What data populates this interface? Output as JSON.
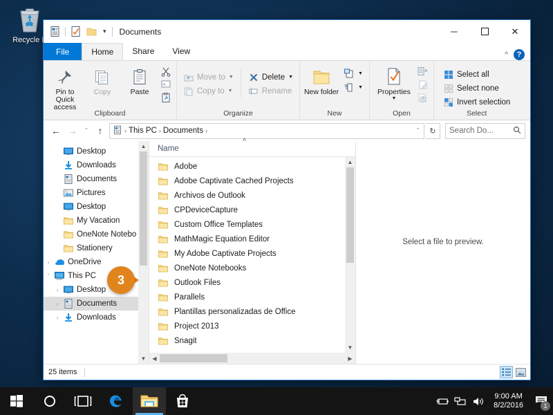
{
  "desktop": {
    "icons": [
      {
        "label": "Recycle B",
        "name": "recycle-bin"
      }
    ]
  },
  "window": {
    "title": "Documents",
    "quick_access": [
      "documents-icon",
      "properties-icon",
      "folder-icon"
    ],
    "controls": {
      "minimize": "─",
      "maximize": "☐",
      "close": "✕"
    },
    "tabs": [
      {
        "label": "File",
        "id": "file"
      },
      {
        "label": "Home",
        "id": "home"
      },
      {
        "label": "Share",
        "id": "share"
      },
      {
        "label": "View",
        "id": "view"
      }
    ],
    "active_tab": "Home",
    "collapse_ribbon": "^",
    "help_label": "?"
  },
  "ribbon": {
    "groups": [
      {
        "label": "Clipboard",
        "big_buttons": [
          {
            "label": "Pin to Quick access",
            "icon": "pin-icon",
            "enabled": true
          },
          {
            "label": "Copy",
            "icon": "copy-icon",
            "enabled": false
          },
          {
            "label": "Paste",
            "icon": "paste-icon",
            "enabled": true
          }
        ],
        "mini_icons": [
          "cut-icon",
          "copy-path-icon",
          "paste-shortcut-icon"
        ]
      },
      {
        "label": "Organize",
        "small_buttons": [
          {
            "label": "Move to",
            "icon": "move-to-icon",
            "caret": true,
            "enabled": false
          },
          {
            "label": "Copy to",
            "icon": "copy-to-icon",
            "caret": true,
            "enabled": false
          },
          {
            "label": "Delete",
            "icon": "delete-icon",
            "caret": true,
            "enabled": true
          },
          {
            "label": "Rename",
            "icon": "rename-icon",
            "caret": false,
            "enabled": false
          }
        ]
      },
      {
        "label": "New",
        "big_buttons": [
          {
            "label": "New folder",
            "icon": "new-folder-icon",
            "enabled": true
          }
        ],
        "small_buttons": [
          {
            "label": "",
            "icon": "new-item-icon",
            "caret": true,
            "enabled": true
          },
          {
            "label": "",
            "icon": "easy-access-icon",
            "caret": true,
            "enabled": true
          }
        ]
      },
      {
        "label": "Open",
        "big_buttons": [
          {
            "label": "Properties",
            "icon": "properties-icon",
            "enabled": true,
            "caret": true
          }
        ],
        "mini_icons": [
          "open-icon",
          "edit-icon",
          "history-icon"
        ]
      },
      {
        "label": "Select",
        "small_buttons": [
          {
            "label": "Select all",
            "icon": "select-all-icon",
            "caret": false,
            "enabled": true
          },
          {
            "label": "Select none",
            "icon": "select-none-icon",
            "caret": false,
            "enabled": true
          },
          {
            "label": "Invert selection",
            "icon": "invert-selection-icon",
            "caret": false,
            "enabled": true
          }
        ]
      }
    ]
  },
  "address": {
    "back": "←",
    "forward": "→",
    "recent": "ˇ",
    "up": "↑",
    "breadcrumbs": [
      "This PC",
      "Documents"
    ],
    "separator": "›",
    "dropdown": "ˇ",
    "refresh": "↻",
    "search_placeholder": "Search Do...",
    "search_value": ""
  },
  "navigation": {
    "items": [
      {
        "label": "Desktop",
        "icon": "desktop-icon",
        "indent": 1,
        "pinned": true,
        "selected": false,
        "expander": ""
      },
      {
        "label": "Downloads",
        "icon": "downloads-icon",
        "indent": 1,
        "pinned": true,
        "selected": false,
        "expander": ""
      },
      {
        "label": "Documents",
        "icon": "documents-icon",
        "indent": 1,
        "pinned": true,
        "selected": false,
        "expander": ""
      },
      {
        "label": "Pictures",
        "icon": "pictures-icon",
        "indent": 1,
        "pinned": true,
        "selected": false,
        "expander": ""
      },
      {
        "label": "Desktop",
        "icon": "desktop-icon",
        "indent": 1,
        "pinned": false,
        "selected": false,
        "expander": ""
      },
      {
        "label": "My Vacation",
        "icon": "folder-icon",
        "indent": 1,
        "pinned": false,
        "selected": false,
        "expander": ""
      },
      {
        "label": "OneNote Notebo",
        "icon": "folder-icon",
        "indent": 1,
        "pinned": false,
        "selected": false,
        "expander": ""
      },
      {
        "label": "Stationery",
        "icon": "folder-icon",
        "indent": 1,
        "pinned": false,
        "selected": false,
        "expander": ""
      },
      {
        "label": "OneDrive",
        "icon": "onedrive-icon",
        "indent": 0,
        "pinned": false,
        "selected": false,
        "expander": "›"
      },
      {
        "label": "This PC",
        "icon": "this-pc-icon",
        "indent": 0,
        "pinned": false,
        "selected": false,
        "expander": "ˇ"
      },
      {
        "label": "Desktop",
        "icon": "desktop-icon",
        "indent": 1,
        "pinned": false,
        "selected": false,
        "expander": "›"
      },
      {
        "label": "Documents",
        "icon": "documents-icon",
        "indent": 1,
        "pinned": false,
        "selected": true,
        "expander": "›"
      },
      {
        "label": "Downloads",
        "icon": "downloads-icon",
        "indent": 1,
        "pinned": false,
        "selected": false,
        "expander": "›"
      }
    ]
  },
  "filelist": {
    "column_header": "Name",
    "sort_indicator": "˄",
    "items": [
      {
        "name": "Adobe",
        "icon": "folder-icon"
      },
      {
        "name": "Adobe Captivate Cached Projects",
        "icon": "folder-icon"
      },
      {
        "name": "Archivos de Outlook",
        "icon": "folder-icon"
      },
      {
        "name": "CPDeviceCapture",
        "icon": "folder-icon"
      },
      {
        "name": "Custom Office Templates",
        "icon": "folder-icon"
      },
      {
        "name": "MathMagic Equation Editor",
        "icon": "folder-icon"
      },
      {
        "name": "My Adobe Captivate Projects",
        "icon": "folder-icon"
      },
      {
        "name": "OneNote Notebooks",
        "icon": "folder-icon"
      },
      {
        "name": "Outlook Files",
        "icon": "folder-icon"
      },
      {
        "name": "Parallels",
        "icon": "folder-icon"
      },
      {
        "name": "Plantillas personalizadas de Office",
        "icon": "folder-icon"
      },
      {
        "name": "Project 2013",
        "icon": "folder-icon"
      },
      {
        "name": "Snagit",
        "icon": "folder-icon"
      }
    ]
  },
  "preview": {
    "message": "Select a file to preview."
  },
  "statusbar": {
    "item_count": "25 items",
    "views": [
      {
        "name": "details-view-button",
        "selected": true
      },
      {
        "name": "large-icons-view-button",
        "selected": false
      }
    ]
  },
  "callout": {
    "number": "3"
  },
  "taskbar": {
    "buttons": [
      {
        "name": "start-button",
        "icon": "windows-logo-icon"
      },
      {
        "name": "cortana-button",
        "icon": "cortana-circle-icon"
      },
      {
        "name": "task-view-button",
        "icon": "task-view-icon"
      },
      {
        "name": "edge-button",
        "icon": "edge-icon"
      },
      {
        "name": "file-explorer-button",
        "icon": "folder-icon",
        "active": true
      },
      {
        "name": "store-button",
        "icon": "store-bag-icon"
      }
    ],
    "tray": [
      "battery-icon",
      "network-icon",
      "volume-icon"
    ],
    "clock_time": "9:00 AM",
    "clock_date": "8/2/2016",
    "notification_count": "1"
  },
  "colors": {
    "accent": "#0078d7",
    "ribbon_bg": "#f2f2f2",
    "callout_orange": "#e0841e",
    "folder_yellow": "#ffd77a"
  }
}
